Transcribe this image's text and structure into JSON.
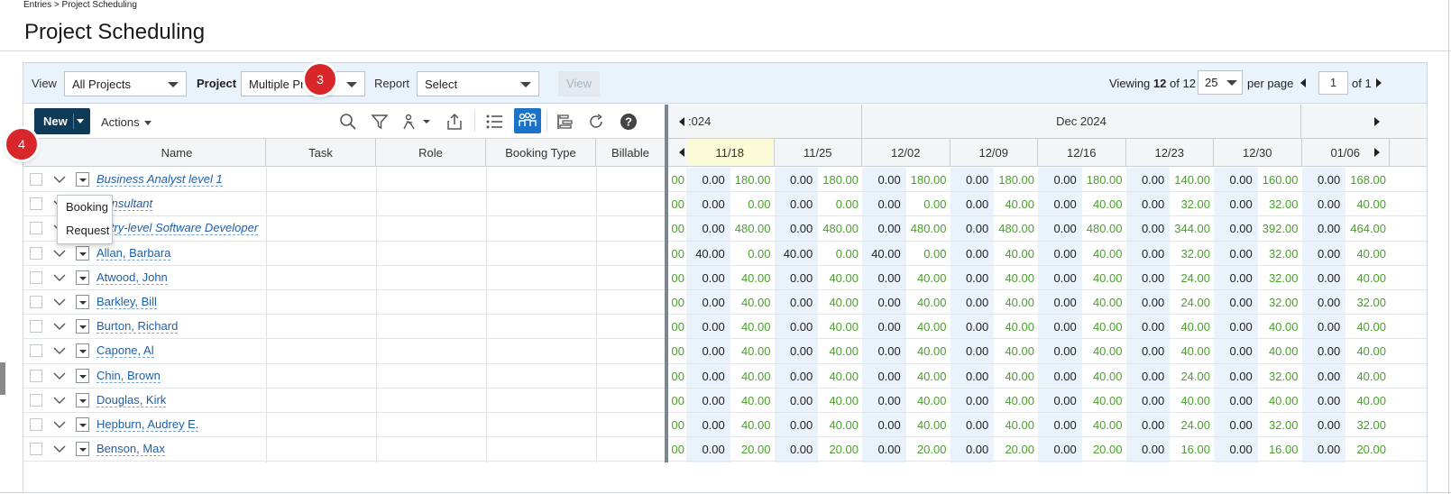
{
  "breadcrumb": "Entries > Project Scheduling",
  "page_title": "Project Scheduling",
  "filters": {
    "view_label": "View",
    "view_value": "All Projects",
    "project_label": "Project",
    "project_value": "Multiple Pro",
    "report_label": "Report",
    "report_value": "Select",
    "view_button": "View"
  },
  "pager": {
    "viewing_prefix": "Viewing",
    "viewing_count": "12",
    "of_text": "of 12",
    "per_page_value": "25",
    "per_page_label": "per page",
    "page_value": "1",
    "page_of": "of 1"
  },
  "badges": {
    "step3": "3",
    "step4": "4"
  },
  "toolbar": {
    "new_label": "New",
    "actions_label": "Actions",
    "icons": [
      "search-icon",
      "filter-icon",
      "assign-icon",
      "export-icon",
      "list-view-icon",
      "resource-view-icon",
      "gantt-icon",
      "refresh-icon",
      "help-icon"
    ]
  },
  "new_menu": [
    "Booking",
    "Request"
  ],
  "columns": {
    "name": "Name",
    "task": "Task",
    "role": "Role",
    "booking_type": "Booking Type",
    "billable": "Billable"
  },
  "timeline": {
    "months": [
      ":024",
      "Dec 2024"
    ],
    "weeks": [
      "11/18",
      "11/25",
      "12/02",
      "12/09",
      "12/16",
      "12/23",
      "12/30",
      "01/06"
    ]
  },
  "rows": [
    {
      "name": "Business Analyst level 1",
      "italic": true,
      "values": [
        "00",
        "0.00",
        "180.00",
        "0.00",
        "180.00",
        "0.00",
        "180.00",
        "0.00",
        "180.00",
        "0.00",
        "180.00",
        "0.00",
        "140.00",
        "0.00",
        "160.00",
        "0.00",
        "168.00"
      ]
    },
    {
      "name": "Consultant",
      "italic": true,
      "values": [
        "00",
        "0.00",
        "0.00",
        "0.00",
        "0.00",
        "0.00",
        "0.00",
        "0.00",
        "40.00",
        "0.00",
        "40.00",
        "0.00",
        "32.00",
        "0.00",
        "32.00",
        "0.00",
        "40.00"
      ]
    },
    {
      "name": "Entry-level Software Developer",
      "italic": true,
      "values": [
        "00",
        "0.00",
        "480.00",
        "0.00",
        "480.00",
        "0.00",
        "480.00",
        "0.00",
        "480.00",
        "0.00",
        "480.00",
        "0.00",
        "344.00",
        "0.00",
        "392.00",
        "0.00",
        "464.00"
      ]
    },
    {
      "name": "Allan, Barbara",
      "italic": false,
      "values": [
        "00",
        "40.00",
        "0.00",
        "40.00",
        "0.00",
        "40.00",
        "0.00",
        "0.00",
        "40.00",
        "0.00",
        "40.00",
        "0.00",
        "32.00",
        "0.00",
        "32.00",
        "0.00",
        "40.00"
      ]
    },
    {
      "name": "Atwood, John",
      "italic": false,
      "values": [
        "00",
        "0.00",
        "40.00",
        "0.00",
        "40.00",
        "0.00",
        "40.00",
        "0.00",
        "40.00",
        "0.00",
        "40.00",
        "0.00",
        "24.00",
        "0.00",
        "32.00",
        "0.00",
        "40.00"
      ]
    },
    {
      "name": "Barkley, Bill",
      "italic": false,
      "values": [
        "00",
        "0.00",
        "40.00",
        "0.00",
        "40.00",
        "0.00",
        "40.00",
        "0.00",
        "40.00",
        "0.00",
        "40.00",
        "0.00",
        "24.00",
        "0.00",
        "32.00",
        "0.00",
        "32.00"
      ]
    },
    {
      "name": "Burton, Richard",
      "italic": false,
      "values": [
        "00",
        "0.00",
        "40.00",
        "0.00",
        "40.00",
        "0.00",
        "40.00",
        "0.00",
        "40.00",
        "0.00",
        "40.00",
        "0.00",
        "40.00",
        "0.00",
        "40.00",
        "0.00",
        "40.00"
      ]
    },
    {
      "name": "Capone, Al",
      "italic": false,
      "values": [
        "00",
        "0.00",
        "40.00",
        "0.00",
        "40.00",
        "0.00",
        "40.00",
        "0.00",
        "40.00",
        "0.00",
        "40.00",
        "0.00",
        "40.00",
        "0.00",
        "40.00",
        "0.00",
        "40.00"
      ]
    },
    {
      "name": "Chin, Brown",
      "italic": false,
      "values": [
        "00",
        "0.00",
        "40.00",
        "0.00",
        "40.00",
        "0.00",
        "40.00",
        "0.00",
        "40.00",
        "0.00",
        "40.00",
        "0.00",
        "24.00",
        "0.00",
        "32.00",
        "0.00",
        "40.00"
      ]
    },
    {
      "name": "Douglas, Kirk",
      "italic": false,
      "values": [
        "00",
        "0.00",
        "40.00",
        "0.00",
        "40.00",
        "0.00",
        "40.00",
        "0.00",
        "40.00",
        "0.00",
        "40.00",
        "0.00",
        "40.00",
        "0.00",
        "40.00",
        "0.00",
        "40.00"
      ]
    },
    {
      "name": "Hepburn, Audrey E.",
      "italic": false,
      "values": [
        "00",
        "0.00",
        "40.00",
        "0.00",
        "40.00",
        "0.00",
        "40.00",
        "0.00",
        "40.00",
        "0.00",
        "40.00",
        "0.00",
        "24.00",
        "0.00",
        "32.00",
        "0.00",
        "32.00"
      ]
    },
    {
      "name": "Benson, Max",
      "italic": false,
      "values": [
        "00",
        "0.00",
        "20.00",
        "0.00",
        "20.00",
        "0.00",
        "20.00",
        "0.00",
        "20.00",
        "0.00",
        "20.00",
        "0.00",
        "16.00",
        "0.00",
        "16.00",
        "0.00",
        "20.00"
      ]
    }
  ],
  "colors": {
    "primary_button": "#0e3b57",
    "link": "#1f5fa8",
    "hours_green": "#4aa02c",
    "badge_red": "#d9262b",
    "active_tool": "#1a73c8"
  }
}
